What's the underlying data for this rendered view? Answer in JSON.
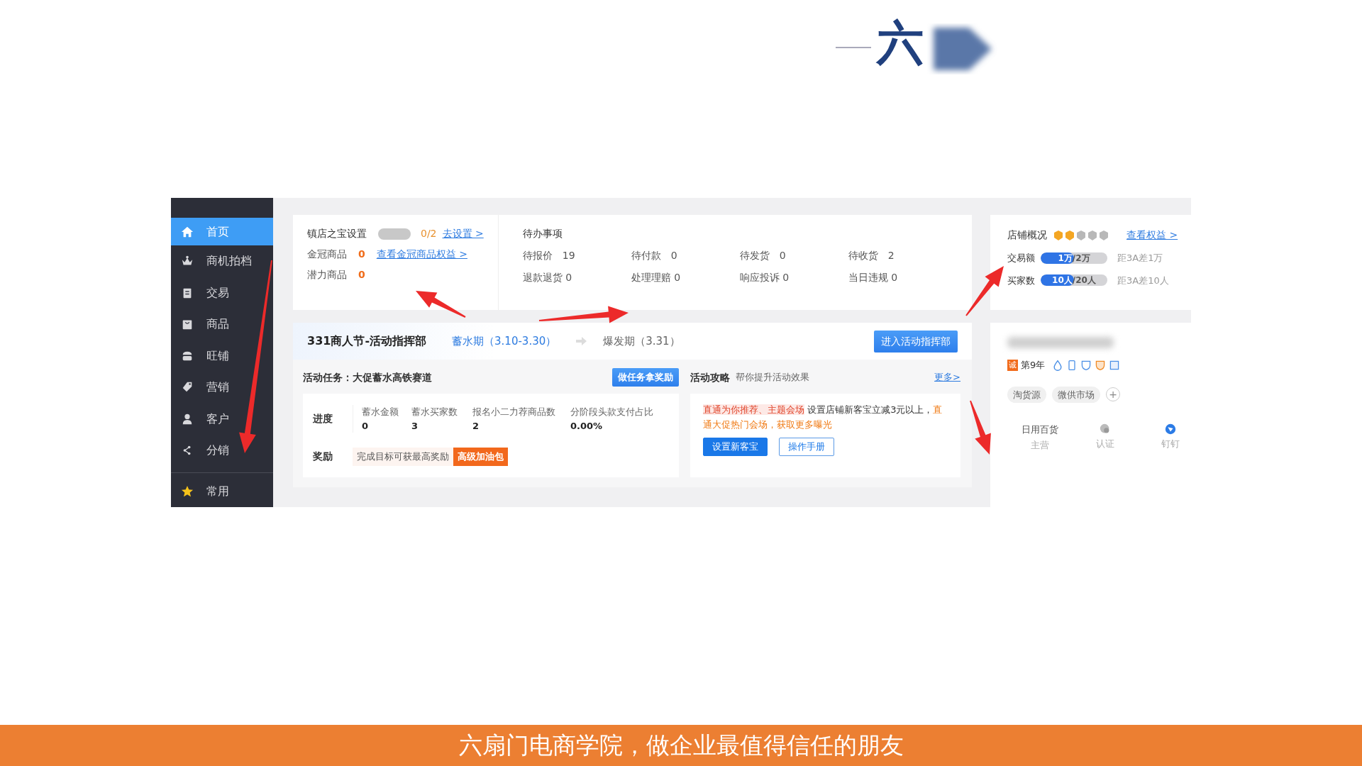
{
  "slide_title": "六",
  "screenshot": {
    "sidebar": {
      "items": [
        {
          "label": "首页",
          "selected": true
        },
        {
          "label": "商机拍档",
          "selected": false
        },
        {
          "label": "交易",
          "selected": false
        },
        {
          "label": "商品",
          "selected": false
        },
        {
          "label": "旺铺",
          "selected": false
        },
        {
          "label": "营销",
          "selected": false
        },
        {
          "label": "客户",
          "selected": false
        },
        {
          "label": "分销",
          "selected": false
        }
      ],
      "pinned": {
        "label": "常用"
      }
    },
    "showcase": {
      "title": "镇店之宝设置",
      "switch_on": false,
      "count": "0/2",
      "link": "去设置 >",
      "rows": [
        {
          "label": "金冠商品",
          "value": "0",
          "link": "查看金冠商品权益 >"
        },
        {
          "label": "潜力商品",
          "value": "0"
        }
      ]
    },
    "todo": {
      "title": "待办事项",
      "items": [
        {
          "label": "待报价",
          "value": "19"
        },
        {
          "label": "待付款",
          "value": "0"
        },
        {
          "label": "待发货",
          "value": "0"
        },
        {
          "label": "待收货",
          "value": "2"
        },
        {
          "label": "退款退货",
          "value": "0"
        },
        {
          "label": "处理理赔",
          "value": "0"
        },
        {
          "label": "响应投诉",
          "value": "0"
        },
        {
          "label": "当日违规",
          "value": "0"
        }
      ]
    },
    "store": {
      "title": "店铺概况",
      "stars": 2,
      "link": "查看权益 >",
      "metrics": [
        {
          "label": "交易额",
          "done": "1万",
          "target": "/2万",
          "level": 0.5,
          "note": "距3A差1万"
        },
        {
          "label": "买家数",
          "done": "10人",
          "target": "/20人",
          "level": 0.5,
          "note": "距3A差10人"
        }
      ]
    },
    "campaign": {
      "title": "331商人节-活动指挥部",
      "phases": [
        {
          "label": "蓄水期（3.10-3.30）",
          "selected": true
        },
        {
          "label": "爆发期（3.31）",
          "selected": false
        }
      ],
      "button": "进入活动指挥部",
      "task": {
        "title": "活动任务：大促蓄水高铁赛道",
        "button": "做任务拿奖励",
        "progress_label": "进度",
        "stats": [
          {
            "label": "蓄水金额",
            "value": "0"
          },
          {
            "label": "蓄水买家数",
            "value": "3"
          },
          {
            "label": "报名小二力荐商品数",
            "value": "2"
          },
          {
            "label": "分阶段头款支付占比",
            "value": "0.00%"
          }
        ],
        "reward_label": "奖励",
        "reward_text": "完成目标可获最高奖励",
        "reward_tag": "高级加油包"
      },
      "guide": {
        "title": "活动攻略",
        "subtitle": "帮你提升活动效果",
        "more": "更多>",
        "segments": [
          {
            "kind": "highlight",
            "text": "直通为你推荐、主题会场"
          },
          {
            "kind": "plain",
            "text": " 设置店铺新客宝立减3元以上，"
          },
          {
            "kind": "accent",
            "text": "直通大促热门会场，获取更多曝光"
          }
        ],
        "buttons": [
          {
            "kind": "primary",
            "label": "设置新客宝"
          },
          {
            "kind": "outline",
            "label": "操作手册"
          }
        ]
      }
    },
    "profile": {
      "badge": "诚",
      "years": "第9年",
      "tags": [
        "淘货源",
        "微供市场"
      ],
      "add": "+",
      "facts": [
        {
          "kind": "text",
          "value": "日用百货",
          "label": "主营"
        },
        {
          "kind": "icon",
          "label": "认证"
        },
        {
          "kind": "icon",
          "label": "钉钉"
        }
      ]
    }
  },
  "footer": "六扇门电商学院，做企业最值得信任的朋友"
}
